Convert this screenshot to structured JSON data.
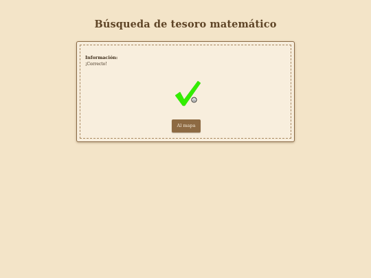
{
  "header": {
    "title": "Búsqueda de tesoro matemático"
  },
  "panel": {
    "info_heading": "Información:",
    "info_text": "¡Correcto!",
    "result_icon": "checkmark-icon",
    "result_icon_color": "#33ee00",
    "cursor_icon": "smiley-icon",
    "button_label": "Al mapa"
  },
  "colors": {
    "background": "#f3e4c8",
    "panel_background": "#f8eedd",
    "title": "#5f4527",
    "button": "#8d6a43"
  }
}
